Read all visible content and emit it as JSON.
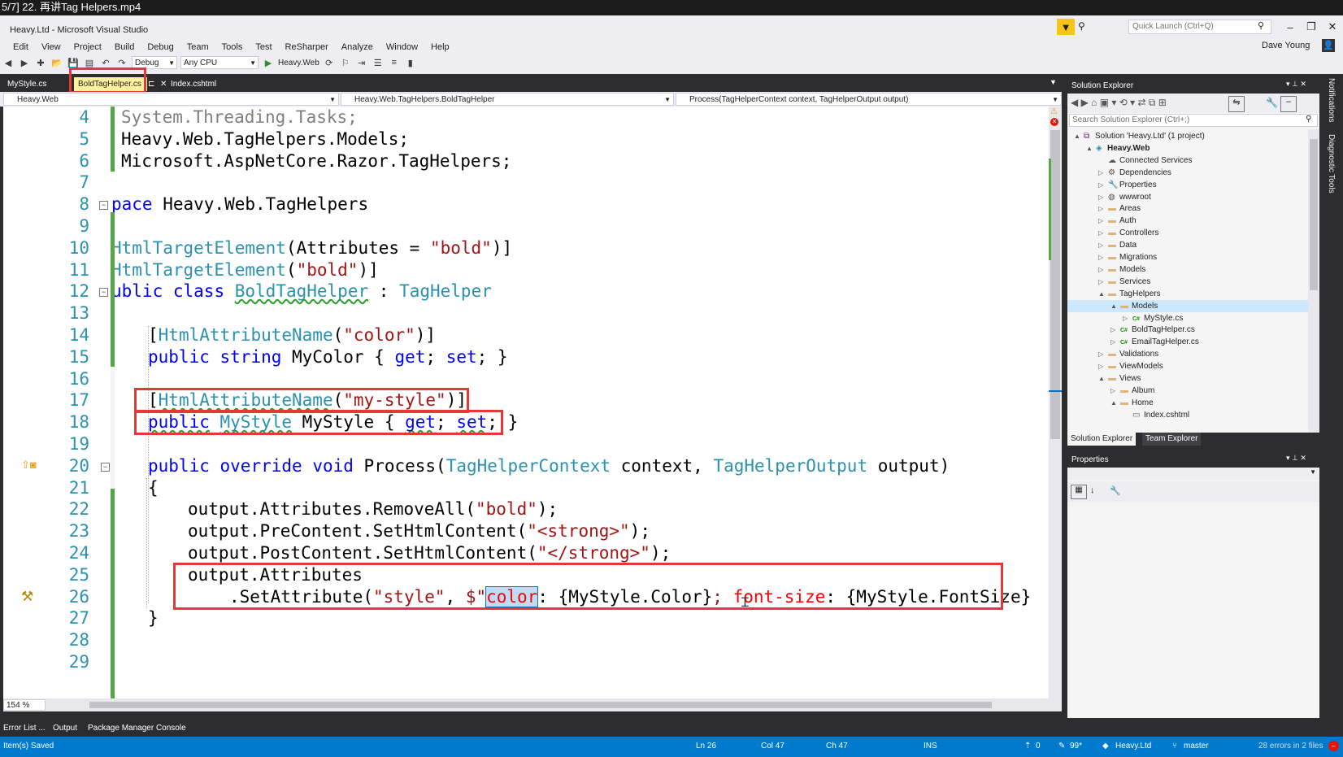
{
  "video_title": "5/7] 22. 再讲Tag Helpers.mp4",
  "window": {
    "title": "Heavy.Ltd - Microsoft Visual Studio",
    "quick_launch_placeholder": "Quick Launch (Ctrl+Q)",
    "user": "Dave Young"
  },
  "menu": [
    "Edit",
    "View",
    "Project",
    "Build",
    "Debug",
    "Team",
    "Tools",
    "Test",
    "ReSharper",
    "Analyze",
    "Window",
    "Help"
  ],
  "toolbar": {
    "config": "Debug",
    "platform": "Any CPU",
    "start_project": "Heavy.Web"
  },
  "doc_tabs": [
    {
      "label": "MyStyle.cs",
      "active": false
    },
    {
      "label": "BoldTagHelper.cs",
      "active": true
    },
    {
      "label": "Index.cshtml",
      "active": false
    }
  ],
  "nav": {
    "project": "Heavy.Web",
    "class": "Heavy.Web.TagHelpers.BoldTagHelper",
    "member": "Process(TagHelperContext context, TagHelperOutput output)"
  },
  "code": [
    {
      "n": "4",
      "text": "System.Threading.Tasks;"
    },
    {
      "n": "5",
      "text": "Heavy.Web.TagHelpers.Models;"
    },
    {
      "n": "6",
      "text": "Microsoft.AspNetCore.Razor.TagHelpers;"
    },
    {
      "n": "7",
      "text": ""
    },
    {
      "n": "8",
      "text": "pace Heavy.Web.TagHelpers"
    },
    {
      "n": "9",
      "text": ""
    },
    {
      "n": "10",
      "text": "HtmlTargetElement(Attributes = \"bold\")]"
    },
    {
      "n": "11",
      "text": "HtmlTargetElement(\"bold\")]"
    },
    {
      "n": "12",
      "text": "ublic class BoldTagHelper : TagHelper"
    },
    {
      "n": "13",
      "text": ""
    },
    {
      "n": "14",
      "text": "[HtmlAttributeName(\"color\")]"
    },
    {
      "n": "15",
      "text": "public string MyColor { get; set; }"
    },
    {
      "n": "16",
      "text": ""
    },
    {
      "n": "17",
      "text": "[HtmlAttributeName(\"my-style\")]"
    },
    {
      "n": "18",
      "text": "public MyStyle MyStyle { get; set; }"
    },
    {
      "n": "19",
      "text": ""
    },
    {
      "n": "20",
      "text": "public override void Process(TagHelperContext context, TagHelperOutput output)"
    },
    {
      "n": "21",
      "text": "{"
    },
    {
      "n": "22",
      "text": "output.Attributes.RemoveAll(\"bold\");"
    },
    {
      "n": "23",
      "text": "output.PreContent.SetHtmlContent(\"<strong>\");"
    },
    {
      "n": "24",
      "text": "output.PostContent.SetHtmlContent(\"</strong>\");"
    },
    {
      "n": "25",
      "text": "output.Attributes"
    },
    {
      "n": "26",
      "text": ".SetAttribute(\"style\", $\"color: {MyStyle.Color}; font-size: {MyStyle.FontSize}"
    },
    {
      "n": "27",
      "text": "}"
    },
    {
      "n": "28",
      "text": ""
    },
    {
      "n": "29",
      "text": ""
    }
  ],
  "zoom": "154 %",
  "solution_explorer": {
    "title": "Solution Explorer",
    "search_placeholder": "Search Solution Explorer (Ctrl+;)",
    "items": [
      {
        "label": "Solution 'Heavy.Ltd' (1 project)",
        "icon": "solution-icon"
      },
      {
        "label": "Heavy.Web",
        "icon": "project-icon"
      },
      {
        "label": "Connected Services",
        "icon": "connected-services-icon"
      },
      {
        "label": "Dependencies",
        "icon": "dependencies-icon"
      },
      {
        "label": "Properties",
        "icon": "wrench-icon"
      },
      {
        "label": "wwwroot",
        "icon": "globe-icon"
      },
      {
        "label": "Areas",
        "icon": "folder-icon"
      },
      {
        "label": "Auth",
        "icon": "folder-icon"
      },
      {
        "label": "Controllers",
        "icon": "folder-icon"
      },
      {
        "label": "Data",
        "icon": "folder-icon"
      },
      {
        "label": "Migrations",
        "icon": "folder-icon"
      },
      {
        "label": "Models",
        "icon": "folder-icon"
      },
      {
        "label": "Services",
        "icon": "folder-icon"
      },
      {
        "label": "TagHelpers",
        "icon": "folder-icon"
      },
      {
        "label": "Models",
        "icon": "folder-icon"
      },
      {
        "label": "MyStyle.cs",
        "icon": "csharp-file-icon"
      },
      {
        "label": "BoldTagHelper.cs",
        "icon": "csharp-file-icon"
      },
      {
        "label": "EmailTagHelper.cs",
        "icon": "csharp-file-icon"
      },
      {
        "label": "Validations",
        "icon": "folder-icon"
      },
      {
        "label": "ViewModels",
        "icon": "folder-icon"
      },
      {
        "label": "Views",
        "icon": "folder-icon"
      },
      {
        "label": "Album",
        "icon": "folder-icon"
      },
      {
        "label": "Home",
        "icon": "folder-icon"
      },
      {
        "label": "Index.cshtml",
        "icon": "cshtml-file-icon"
      }
    ],
    "tabs": [
      "Solution Explorer",
      "Team Explorer"
    ]
  },
  "properties": {
    "title": "Properties"
  },
  "side_tabs": [
    "Notifications",
    "Diagnostic Tools"
  ],
  "bottom_tabs": [
    "Error List ...",
    "Output",
    "Package Manager Console"
  ],
  "status": {
    "message": "Item(s) Saved",
    "ln": "Ln 26",
    "col": "Col 47",
    "ch": "Ch 47",
    "mode": "INS",
    "up": "0",
    "pencil": "99*",
    "repo": "Heavy.Ltd",
    "branch": "master",
    "errors": "28 errors in 2 files"
  },
  "colors": {
    "accent": "#007acc",
    "highlight_box": "#e53935",
    "tab_active": "#fff29d"
  }
}
